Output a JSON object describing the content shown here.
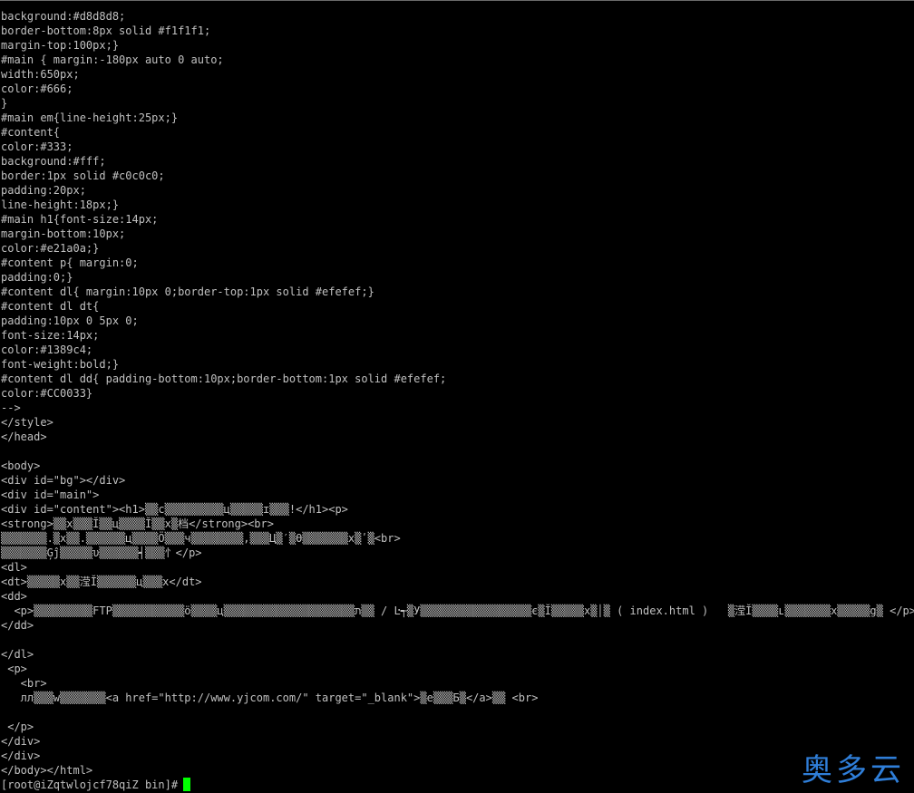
{
  "terminal": {
    "background_color": "#000000",
    "text_color": "#c0c0c0",
    "cursor_color": "#00ff00",
    "lines": [
      "background:#d8d8d8;",
      "border-bottom:8px solid #f1f1f1;",
      "margin-top:100px;}",
      "#main { margin:-180px auto 0 auto;",
      "width:650px;",
      "color:#666;",
      "}",
      "#main em{line-height:25px;}",
      "#content{",
      "color:#333;",
      "background:#fff;",
      "border:1px solid #c0c0c0;",
      "padding:20px;",
      "line-height:18px;}",
      "#main h1{font-size:14px;",
      "margin-bottom:10px;",
      "color:#e21a0a;}",
      "#content p{ margin:0;",
      "padding:0;}",
      "#content dl{ margin:10px 0;border-top:1px solid #efefef;}",
      "#content dl dt{",
      "padding:10px 0 5px 0;",
      "font-size:14px;",
      "color:#1389c4;",
      "font-weight:bold;}",
      "#content dl dd{ padding-bottom:10px;border-bottom:1px solid #efefef;",
      "color:#CC0033}",
      "-->",
      "</style>",
      "</head>",
      "",
      "<body>",
      "<div id=\"bg\"></div>",
      "<div id=\"main\">",
      "<div id=\"content\"><h1>▒▒c▒▒▒▒▒▒▒▒▒ц▒▒▒▒▒ɪ▒▒▒!</h1><p>",
      "<strong>▒▒x▒▒▒Ĭ▒▒ц▒▒▒▒Ĭ▒▒x▒档</strong><br>",
      "▒▒▒▒▒▒▒.▒x▒▒.▒▒▒▒▒▒ц▒▒▒▒Ö▒▒▒ч▒▒▒▒▒▒▒▒,▒▒▒Ц▒′▒ϴ▒▒▒▒▒▒▒x▒ʹ▒<br>",
      "▒▒▒▒▒▒▒Ģĵ▒▒▒▒▒υ▒▒▒▒▒▒┥▒▒▒忄</p>",
      "<dl>",
      "<dt>▒▒▒▒▒x▒▒滢Ĭ▒▒▒▒▒▒ц▒▒▒x</dt>",
      "<dd>",
      "  <p>▒▒▒▒▒▒▒▒▒FTP▒▒▒▒▒▒▒▒▒▒▒ö▒▒▒▒ц▒▒▒▒▒▒▒▒▒▒▒▒▒▒▒▒▒▒▒▒ת▒▒ / Ŀ┭▒У▒▒▒▒▒▒▒▒▒▒▒▒▒▒▒▒▒є▒Ĭ▒▒▒▒▒x▒│▒ ( index.html )   ▒滢Ĭ▒▒▒▒ʟ▒▒▒▒▒▒▒x▒▒▒▒▒g▒ </p>",
      "</dd>",
      "",
      "</dl>",
      " <p>",
      "   <br>",
      "   лл▒▒▒w▒▒▒▒▒▒▒<a href=\"http://www.yjcom.com/\" target=\"_blank\">▒e▒▒▒Б▒</a>▒▒ <br>",
      "",
      " </p>",
      "</div>",
      "</div>",
      "</body></html>"
    ],
    "prompt": "[root@iZqtwlojcf78qiZ bin]#"
  },
  "watermark": {
    "text": "奥多云",
    "color": "#2f7ed8"
  }
}
